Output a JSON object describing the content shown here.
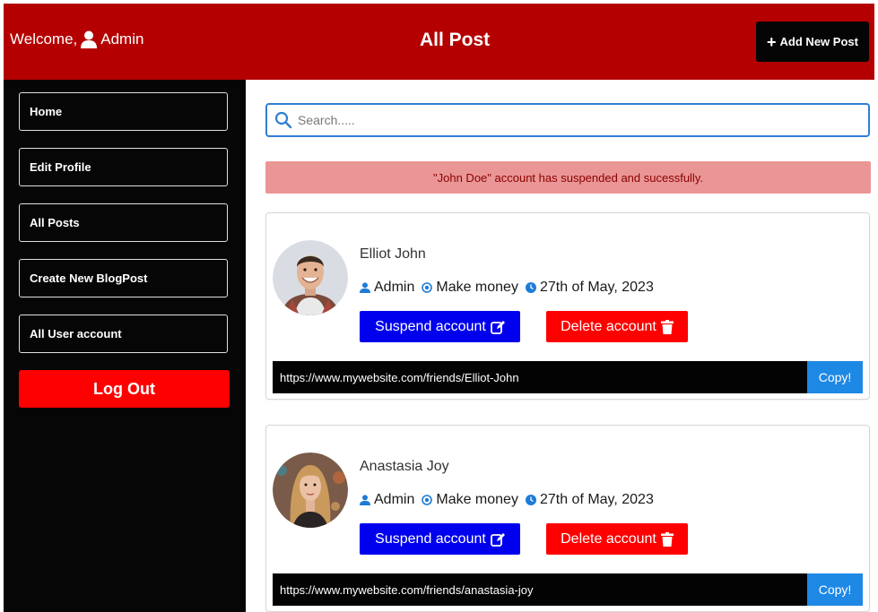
{
  "header": {
    "welcome_text": "Welcome,",
    "user_name": "Admin",
    "title": "All Post",
    "add_button_label": "Add New Post"
  },
  "sidebar": {
    "items": [
      {
        "label": "Home"
      },
      {
        "label": "Edit Profile"
      },
      {
        "label": "All Posts"
      },
      {
        "label": "Create New BlogPost"
      },
      {
        "label": "All User account"
      }
    ],
    "logout_label": "Log Out"
  },
  "search": {
    "placeholder": "Search.....",
    "value": ""
  },
  "alert": {
    "message": "\"John Doe\" account has suspended and sucessfully."
  },
  "posts": [
    {
      "name": "Elliot John",
      "author": "Admin",
      "category": "Make money",
      "date": "27th of May, 2023",
      "suspend_label": "Suspend account",
      "delete_label": "Delete account",
      "url": "https://www.mywebsite.com/friends/Elliot-John",
      "copy_label": "Copy!"
    },
    {
      "name": "Anastasia Joy",
      "author": "Admin",
      "category": "Make money",
      "date": "27th of May, 2023",
      "suspend_label": "Suspend account",
      "delete_label": "Delete account",
      "url": "https://www.mywebsite.com/friends/anastasia-joy",
      "copy_label": "Copy!"
    }
  ],
  "colors": {
    "header_bg": "#b40000",
    "sidebar_bg": "#060606",
    "logout_bg": "#ff0000",
    "suspend_bg": "#0000ee",
    "delete_bg": "#ff0000",
    "copy_bg": "#1e88e5",
    "alert_bg": "#ea9696",
    "search_border": "#2f7fd4"
  },
  "icons": {
    "welcome": "user-icon",
    "add": "plus-icon",
    "search": "search-icon",
    "author": "user-icon",
    "category": "globe-icon",
    "date": "clock-icon",
    "suspend": "edit-icon",
    "delete": "trash-icon"
  }
}
